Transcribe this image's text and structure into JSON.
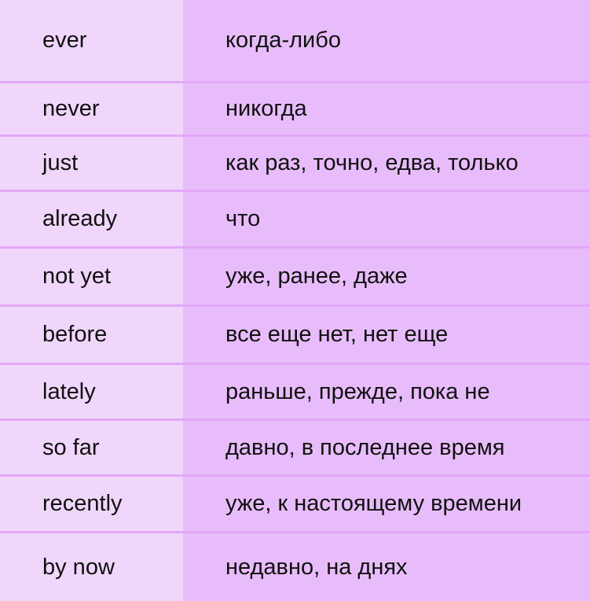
{
  "table": {
    "rows": [
      {
        "en": "ever",
        "ru": "когда-либо"
      },
      {
        "en": "never",
        "ru": "никогда"
      },
      {
        "en": "just",
        "ru": "как раз, точно, едва, только"
      },
      {
        "en": "already",
        "ru": "что"
      },
      {
        "en": "not yet",
        "ru": "уже, ранее, даже"
      },
      {
        "en": "before",
        "ru": "все еще нет, нет еще"
      },
      {
        "en": "lately",
        "ru": "раньше, прежде, пока не"
      },
      {
        "en": "so far",
        "ru": "давно, в последнее время"
      },
      {
        "en": "recently",
        "ru": "уже, к настоящему времени"
      },
      {
        "en": "by now",
        "ru": "недавно, на днях"
      }
    ]
  },
  "colors": {
    "left_column": "#f0d6fb",
    "right_column": "#e8bcfa",
    "divider": "#e3a7f8",
    "text": "#111111"
  }
}
